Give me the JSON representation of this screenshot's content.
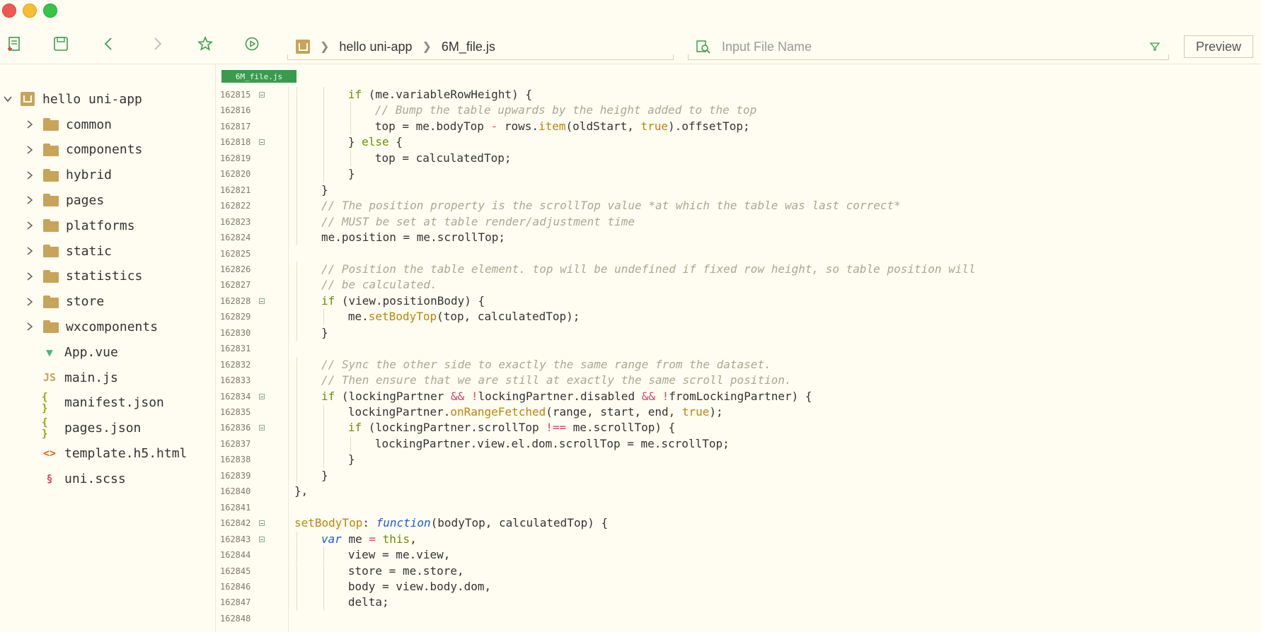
{
  "toolbar": {
    "breadcrumb": {
      "project": "hello uni-app",
      "file": "6M_file.js"
    },
    "search": {
      "placeholder": "Input File Name"
    },
    "preview_label": "Preview"
  },
  "sidebar": {
    "project": "hello uni-app",
    "items": [
      {
        "label": "common",
        "kind": "folder"
      },
      {
        "label": "components",
        "kind": "folder"
      },
      {
        "label": "hybrid",
        "kind": "folder"
      },
      {
        "label": "pages",
        "kind": "folder"
      },
      {
        "label": "platforms",
        "kind": "folder"
      },
      {
        "label": "static",
        "kind": "folder"
      },
      {
        "label": "statistics",
        "kind": "folder"
      },
      {
        "label": "store",
        "kind": "folder"
      },
      {
        "label": "wxcomponents",
        "kind": "folder"
      },
      {
        "label": "App.vue",
        "kind": "vue"
      },
      {
        "label": "main.js",
        "kind": "js"
      },
      {
        "label": "manifest.json",
        "kind": "json"
      },
      {
        "label": "pages.json",
        "kind": "json"
      },
      {
        "label": "template.h5.html",
        "kind": "html"
      },
      {
        "label": "uni.scss",
        "kind": "scss"
      }
    ]
  },
  "editor": {
    "tab_label": "6M_file.js",
    "lines": [
      {
        "n": "162815",
        "fold": true,
        "indent": 2,
        "tokens": [
          [
            "kw",
            "if"
          ],
          [
            "plain",
            " (me.variableRowHeight) {"
          ]
        ]
      },
      {
        "n": "162816",
        "fold": false,
        "indent": 3,
        "tokens": [
          [
            "comment",
            "// Bump the table upwards by the height added to the top"
          ]
        ]
      },
      {
        "n": "162817",
        "fold": false,
        "indent": 3,
        "tokens": [
          [
            "plain",
            "top = me.bodyTop "
          ],
          [
            "op",
            "-"
          ],
          [
            "plain",
            " rows."
          ],
          [
            "fn",
            "item"
          ],
          [
            "plain",
            "(oldStart, "
          ],
          [
            "bool",
            "true"
          ],
          [
            "plain",
            ").offsetTop;"
          ]
        ]
      },
      {
        "n": "162818",
        "fold": true,
        "indent": 2,
        "tokens": [
          [
            "plain",
            "} "
          ],
          [
            "kw",
            "else"
          ],
          [
            "plain",
            " {"
          ]
        ]
      },
      {
        "n": "162819",
        "fold": false,
        "indent": 3,
        "tokens": [
          [
            "plain",
            "top = calculatedTop;"
          ]
        ]
      },
      {
        "n": "162820",
        "fold": false,
        "indent": 2,
        "tokens": [
          [
            "plain",
            "}"
          ]
        ]
      },
      {
        "n": "162821",
        "fold": false,
        "indent": 1,
        "tokens": [
          [
            "plain",
            "}"
          ]
        ]
      },
      {
        "n": "162822",
        "fold": false,
        "indent": 1,
        "tokens": [
          [
            "comment",
            "// The position property is the scrollTop value *at which the table was last correct*"
          ]
        ]
      },
      {
        "n": "162823",
        "fold": false,
        "indent": 1,
        "tokens": [
          [
            "comment",
            "// MUST be set at table render/adjustment time"
          ]
        ]
      },
      {
        "n": "162824",
        "fold": false,
        "indent": 1,
        "tokens": [
          [
            "plain",
            "me.position = me.scrollTop;"
          ]
        ]
      },
      {
        "n": "162825",
        "fold": false,
        "indent": 0,
        "tokens": []
      },
      {
        "n": "162826",
        "fold": false,
        "indent": 1,
        "tokens": [
          [
            "comment",
            "// Position the table element. top will be undefined if fixed row height, so table position will"
          ]
        ]
      },
      {
        "n": "162827",
        "fold": false,
        "indent": 1,
        "tokens": [
          [
            "comment",
            "// be calculated."
          ]
        ]
      },
      {
        "n": "162828",
        "fold": true,
        "indent": 1,
        "tokens": [
          [
            "kw",
            "if"
          ],
          [
            "plain",
            " (view.positionBody) {"
          ]
        ]
      },
      {
        "n": "162829",
        "fold": false,
        "indent": 2,
        "tokens": [
          [
            "plain",
            "me."
          ],
          [
            "fn",
            "setBodyTop"
          ],
          [
            "plain",
            "(top, calculatedTop);"
          ]
        ]
      },
      {
        "n": "162830",
        "fold": false,
        "indent": 1,
        "tokens": [
          [
            "plain",
            "}"
          ]
        ]
      },
      {
        "n": "162831",
        "fold": false,
        "indent": 0,
        "tokens": []
      },
      {
        "n": "162832",
        "fold": false,
        "indent": 1,
        "tokens": [
          [
            "comment",
            "// Sync the other side to exactly the same range from the dataset."
          ]
        ]
      },
      {
        "n": "162833",
        "fold": false,
        "indent": 1,
        "tokens": [
          [
            "comment",
            "// Then ensure that we are still at exactly the same scroll position."
          ]
        ]
      },
      {
        "n": "162834",
        "fold": true,
        "indent": 1,
        "tokens": [
          [
            "kw",
            "if"
          ],
          [
            "plain",
            " (lockingPartner "
          ],
          [
            "op",
            "&&"
          ],
          [
            "plain",
            " "
          ],
          [
            "op",
            "!"
          ],
          [
            "plain",
            "lockingPartner.disabled "
          ],
          [
            "op",
            "&&"
          ],
          [
            "plain",
            " "
          ],
          [
            "op",
            "!"
          ],
          [
            "plain",
            "fromLockingPartner) {"
          ]
        ]
      },
      {
        "n": "162835",
        "fold": false,
        "indent": 2,
        "tokens": [
          [
            "plain",
            "lockingPartner."
          ],
          [
            "fn",
            "onRangeFetched"
          ],
          [
            "plain",
            "(range, start, end, "
          ],
          [
            "bool",
            "true"
          ],
          [
            "plain",
            ");"
          ]
        ]
      },
      {
        "n": "162836",
        "fold": true,
        "indent": 2,
        "tokens": [
          [
            "kw",
            "if"
          ],
          [
            "plain",
            " (lockingPartner.scrollTop "
          ],
          [
            "op",
            "!=="
          ],
          [
            "plain",
            " me.scrollTop) {"
          ]
        ]
      },
      {
        "n": "162837",
        "fold": false,
        "indent": 3,
        "tokens": [
          [
            "plain",
            "lockingPartner.view.el.dom.scrollTop = me.scrollTop;"
          ]
        ]
      },
      {
        "n": "162838",
        "fold": false,
        "indent": 2,
        "tokens": [
          [
            "plain",
            "}"
          ]
        ]
      },
      {
        "n": "162839",
        "fold": false,
        "indent": 1,
        "tokens": [
          [
            "plain",
            "}"
          ]
        ]
      },
      {
        "n": "162840",
        "fold": false,
        "indent": 0,
        "tokens": [
          [
            "plain",
            "},"
          ]
        ]
      },
      {
        "n": "162841",
        "fold": false,
        "indent": 0,
        "tokens": []
      },
      {
        "n": "162842",
        "fold": true,
        "indent": 0,
        "tokens": [
          [
            "fn",
            "setBodyTop"
          ],
          [
            "plain",
            ": "
          ],
          [
            "kw2",
            "function"
          ],
          [
            "plain",
            "(bodyTop, calculatedTop) {"
          ]
        ]
      },
      {
        "n": "162843",
        "fold": true,
        "indent": 1,
        "tokens": [
          [
            "kw2",
            "var"
          ],
          [
            "plain",
            " me "
          ],
          [
            "op",
            "="
          ],
          [
            "plain",
            " "
          ],
          [
            "kw",
            "this"
          ],
          [
            "plain",
            ","
          ]
        ]
      },
      {
        "n": "162844",
        "fold": false,
        "indent": 2,
        "tokens": [
          [
            "plain",
            "view = me.view,"
          ]
        ]
      },
      {
        "n": "162845",
        "fold": false,
        "indent": 2,
        "tokens": [
          [
            "plain",
            "store = me.store,"
          ]
        ]
      },
      {
        "n": "162846",
        "fold": false,
        "indent": 2,
        "tokens": [
          [
            "plain",
            "body = view.body.dom,"
          ]
        ]
      },
      {
        "n": "162847",
        "fold": false,
        "indent": 2,
        "tokens": [
          [
            "plain",
            "delta;"
          ]
        ]
      },
      {
        "n": "162848",
        "fold": false,
        "indent": 0,
        "tokens": []
      }
    ]
  },
  "colors": {
    "background": "#fffdf1",
    "accent_green": "#3a9b4f",
    "folder": "#c8a35a",
    "comment": "#a8a892",
    "keyword": "#6a8f00",
    "function": "#b8860b"
  }
}
